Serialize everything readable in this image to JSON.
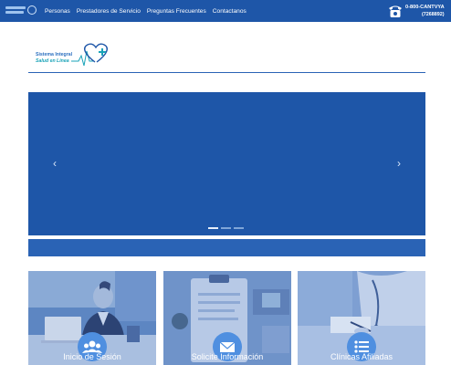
{
  "nav": {
    "items": [
      "Personas",
      "Prestadores de Servicio",
      "Preguntas Frecuentes",
      "Contactanos"
    ]
  },
  "phone": {
    "number": "0-800-CANTVYA",
    "digits": "(7268892)"
  },
  "logo": {
    "line1": "Sistema Integral",
    "line2": "Salud en Línea"
  },
  "carousel": {
    "prev": "‹",
    "next": "›"
  },
  "cards": [
    {
      "label": "Inicio de Sesión",
      "icon": "users-icon"
    },
    {
      "label": "Solicite Información",
      "icon": "envelope-icon"
    },
    {
      "label": "Clínicas Afiliadas",
      "icon": "list-icon"
    }
  ],
  "colors": {
    "primary": "#1e56a8",
    "strip": "#2a63b5",
    "badge": "#4f8fe0"
  }
}
